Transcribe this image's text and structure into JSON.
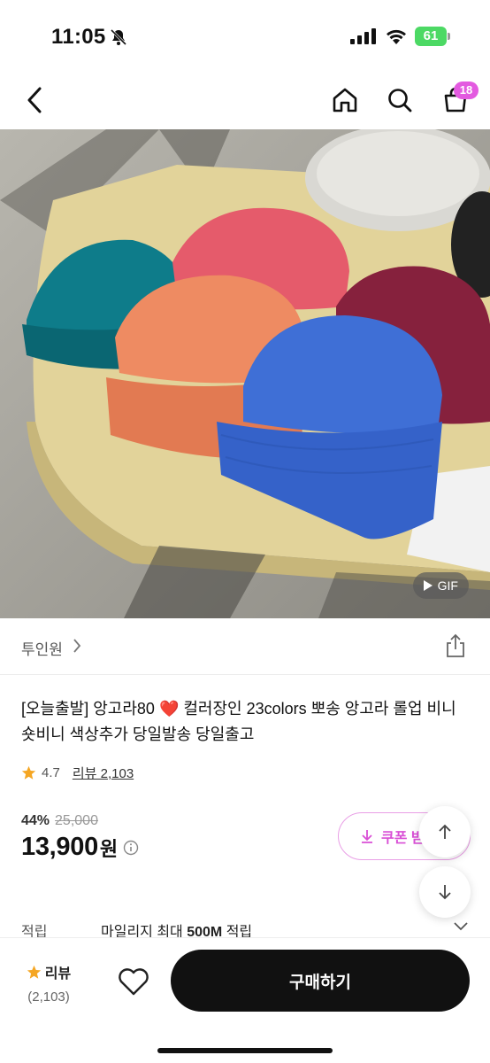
{
  "status_bar": {
    "time": "11:05",
    "battery": "61"
  },
  "nav": {
    "cart_badge": "18"
  },
  "product": {
    "image_badge": "GIF",
    "store_name": "투인원",
    "title": "[오늘출발] 앙고라80 ❤️ 컬러장인 23colors 뽀송 앙고라 롤업 비니 숏비니 색상추가 당일발송 당일출고",
    "rating": "4.7",
    "review_link": "리뷰 2,103",
    "discount_pct": "44%",
    "original_price": "25,000",
    "price": "13,900",
    "currency": "원",
    "coupon_label": "쿠폰 받기"
  },
  "points": {
    "label": "적립",
    "text_prefix": "마일리지 최대 ",
    "text_bold": "500M",
    "text_suffix": " 적립"
  },
  "bottom_bar": {
    "review_label": "리뷰",
    "review_count": "(2,103)",
    "buy_label": "구매하기"
  },
  "colors": {
    "accent": "#d94fd6",
    "badge": "#e35ae0",
    "star": "#f5a623",
    "buy_button": "#111111"
  },
  "icons": [
    "bell-slash-icon",
    "signal-icon",
    "wifi-icon",
    "back-icon",
    "home-icon",
    "search-icon",
    "cart-icon",
    "play-icon",
    "chevron-right-icon",
    "share-icon",
    "star-icon",
    "info-icon",
    "download-icon",
    "arrow-up-icon",
    "arrow-down-icon",
    "chevron-down-icon",
    "heart-icon"
  ]
}
